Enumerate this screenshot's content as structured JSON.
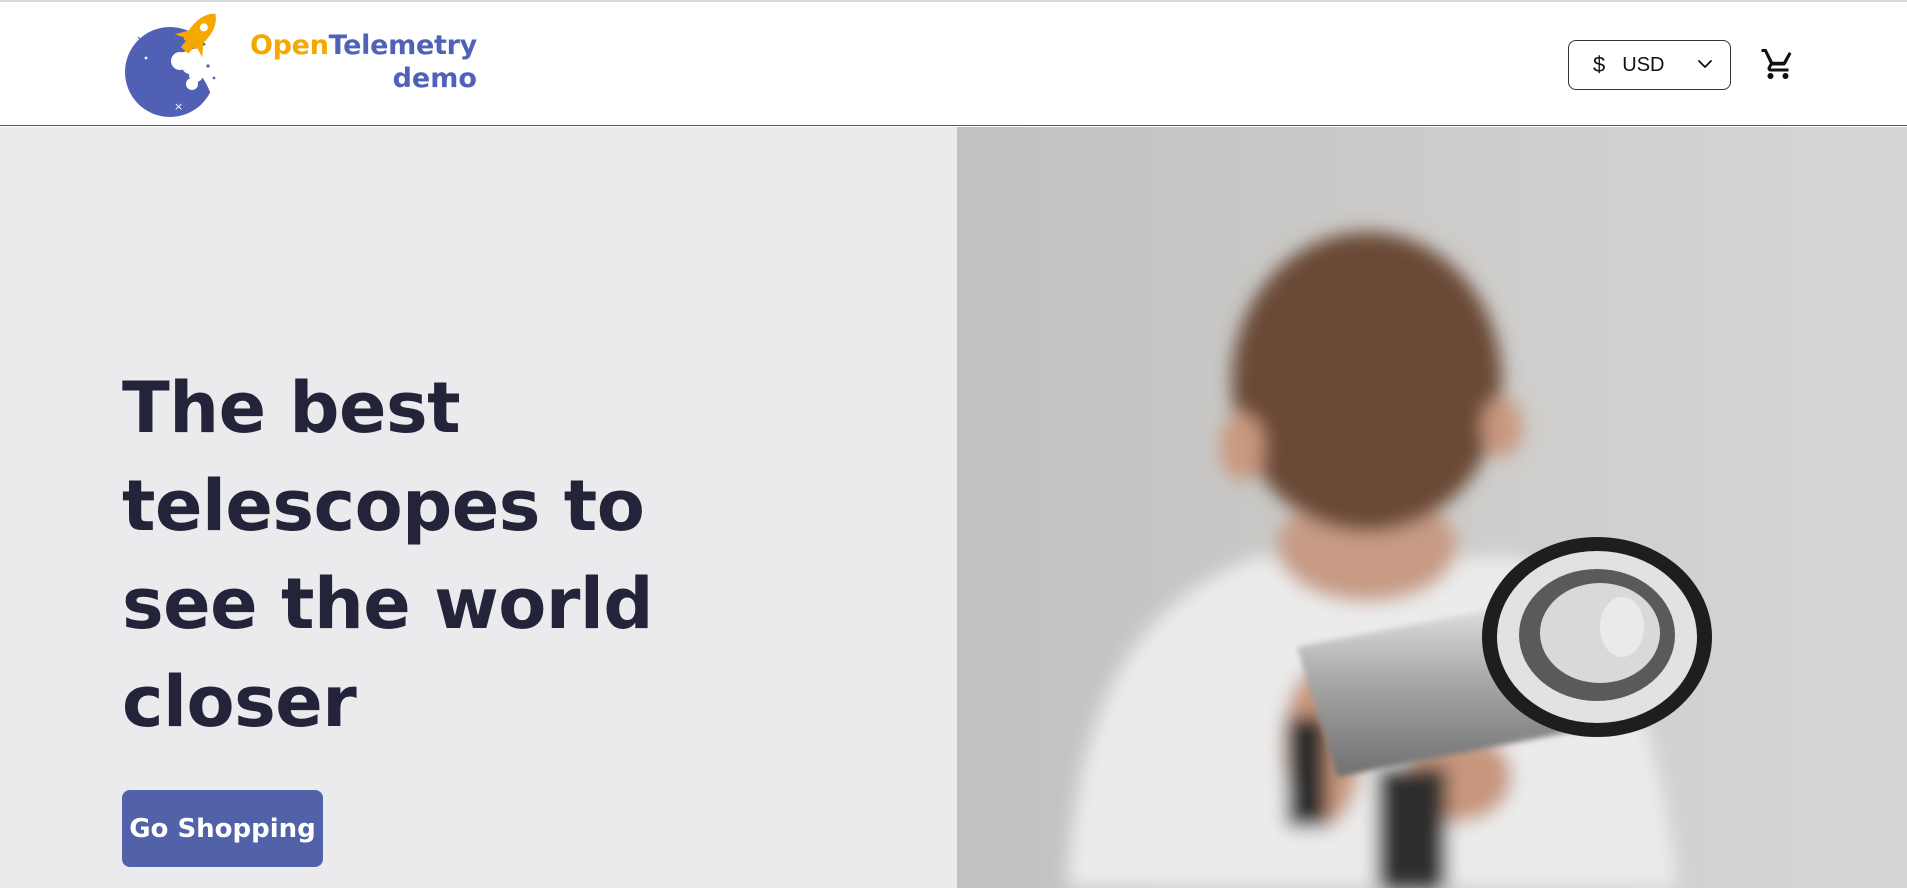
{
  "header": {
    "logo": {
      "word_open": "Open",
      "word_telemetry": "Telemetry",
      "word_demo": "demo"
    },
    "currency": {
      "symbol": "$",
      "code": "USD",
      "icon": "chevron-down-icon"
    },
    "cart": {
      "icon": "cart-icon"
    }
  },
  "hero": {
    "title": "The best telescopes to see the world closer",
    "cta_label": "Go Shopping",
    "image_icon": "child-with-telescope-photo"
  },
  "colors": {
    "brand_orange": "#f5a800",
    "brand_blue": "#4f62b8",
    "cta_bg": "#5262a8",
    "hero_left_bg": "#ebebed",
    "title_text": "#23233a"
  }
}
